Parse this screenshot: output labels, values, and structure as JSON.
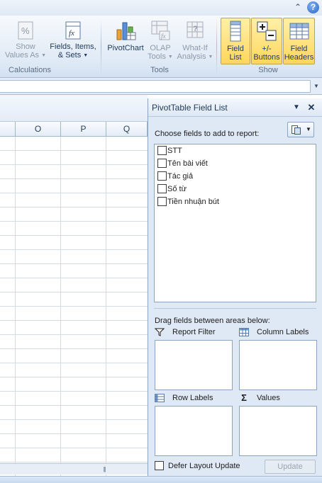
{
  "ribbon": {
    "groups": {
      "calculations": "Calculations",
      "tools": "Tools",
      "show": "Show"
    },
    "buttons": {
      "show_values_as": [
        "Show",
        "Values As"
      ],
      "fields_items_sets": [
        "Fields, Items,",
        "& Sets"
      ],
      "pivotchart": "PivotChart",
      "olap_tools": [
        "OLAP",
        "Tools"
      ],
      "what_if": [
        "What-If",
        "Analysis"
      ],
      "field_list": [
        "Field",
        "List"
      ],
      "buttons": [
        "+/-",
        "Buttons"
      ],
      "field_headers": [
        "Field",
        "Headers"
      ]
    },
    "help_glyph": "?",
    "minimize_glyph": "⌃"
  },
  "sheet": {
    "columns": [
      "O",
      "P",
      "Q"
    ]
  },
  "pane": {
    "title": "PivotTable Field List",
    "choose_label": "Choose fields to add to report:",
    "fields": [
      "STT",
      "Tên bài viết",
      "Tác giả",
      "Số từ",
      "Tiền nhuận bút"
    ],
    "drag_label": "Drag fields between areas below:",
    "areas": {
      "report_filter": "Report Filter",
      "column_labels": "Column Labels",
      "row_labels": "Row Labels",
      "values": "Values"
    },
    "defer_label": "Defer Layout Update",
    "update_label": "Update"
  },
  "colors": {
    "active_button": "#ffd65c",
    "pane_bg": "#dfe8f5",
    "ribbon_bg": "#dde8f5"
  }
}
